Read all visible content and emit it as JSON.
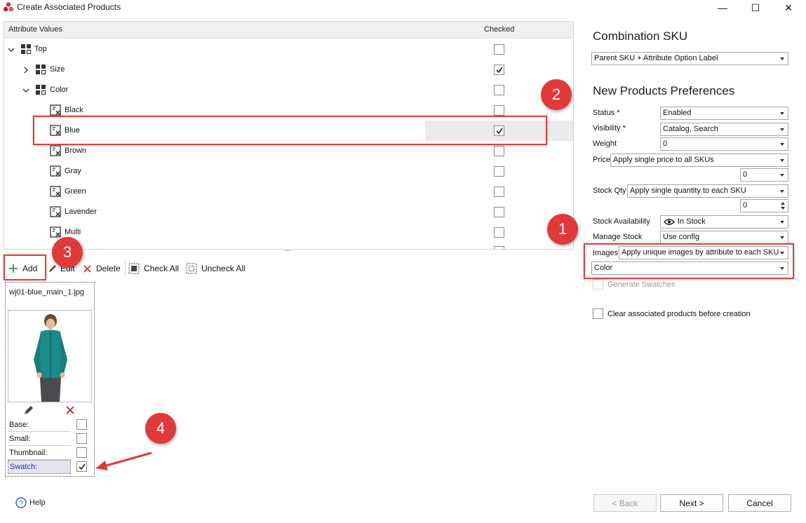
{
  "window": {
    "title": "Create Associated Products",
    "minimize": "—",
    "maximize": "☐",
    "close": "✕"
  },
  "tree": {
    "col_attribute": "Attribute Values",
    "col_checked": "Checked",
    "rows": [
      {
        "label": "Top",
        "checked": false
      },
      {
        "label": "Size",
        "checked": true
      },
      {
        "label": "Color",
        "checked": false
      },
      {
        "label": "Black",
        "checked": false
      },
      {
        "label": "Blue",
        "checked": true
      },
      {
        "label": "Brown",
        "checked": false
      },
      {
        "label": "Gray",
        "checked": false
      },
      {
        "label": "Green",
        "checked": false
      },
      {
        "label": "Lavender",
        "checked": false
      },
      {
        "label": "Multi",
        "checked": false
      }
    ],
    "splitter": "..."
  },
  "toolbar": {
    "add": "Add",
    "edit": "Edit",
    "delete": "Delete",
    "check_all": "Check All",
    "uncheck_all": "Uncheck All"
  },
  "image_card": {
    "filename": "wj01-blue_main_1.jpg",
    "roles": [
      {
        "label": "Base:",
        "checked": false
      },
      {
        "label": "Small:",
        "checked": false
      },
      {
        "label": "Thumbnail:",
        "checked": false
      },
      {
        "label": "Swatch:",
        "checked": true
      }
    ]
  },
  "right_panel": {
    "combination_heading": "Combination SKU",
    "combination_value": "Parent SKU + Attribute Option Label",
    "preferences_heading": "New Products Preferences",
    "status_label": "Status *",
    "status_value": "Enabled",
    "visibility_label": "Visibility *",
    "visibility_value": "Catalog, Search",
    "weight_label": "Weight",
    "weight_value": "0",
    "price_label": "Price",
    "price_mode": "Apply single price to all SKUs",
    "price_value": "0",
    "stock_qty_label": "Stock Qty",
    "stock_qty_mode": "Apply single quantity to each SKU",
    "stock_qty_value": "0",
    "stock_availability_label": "Stock Availability",
    "stock_availability_value": "In Stock",
    "manage_stock_label": "Manage Stock",
    "manage_stock_value": "Use config",
    "images_label": "Images",
    "images_mode": "Apply unique images by attribute to each SKU",
    "images_attribute": "Color",
    "generate_swatches": "Generate Swatches",
    "clear_associated": "Clear associated products before creation"
  },
  "footer": {
    "help": "Help",
    "back": "< Back",
    "next": "Next >",
    "cancel": "Cancel"
  },
  "annotations": {
    "c1": "1",
    "c2": "2",
    "c3": "3",
    "c4": "4",
    "color": "#e0393a"
  }
}
